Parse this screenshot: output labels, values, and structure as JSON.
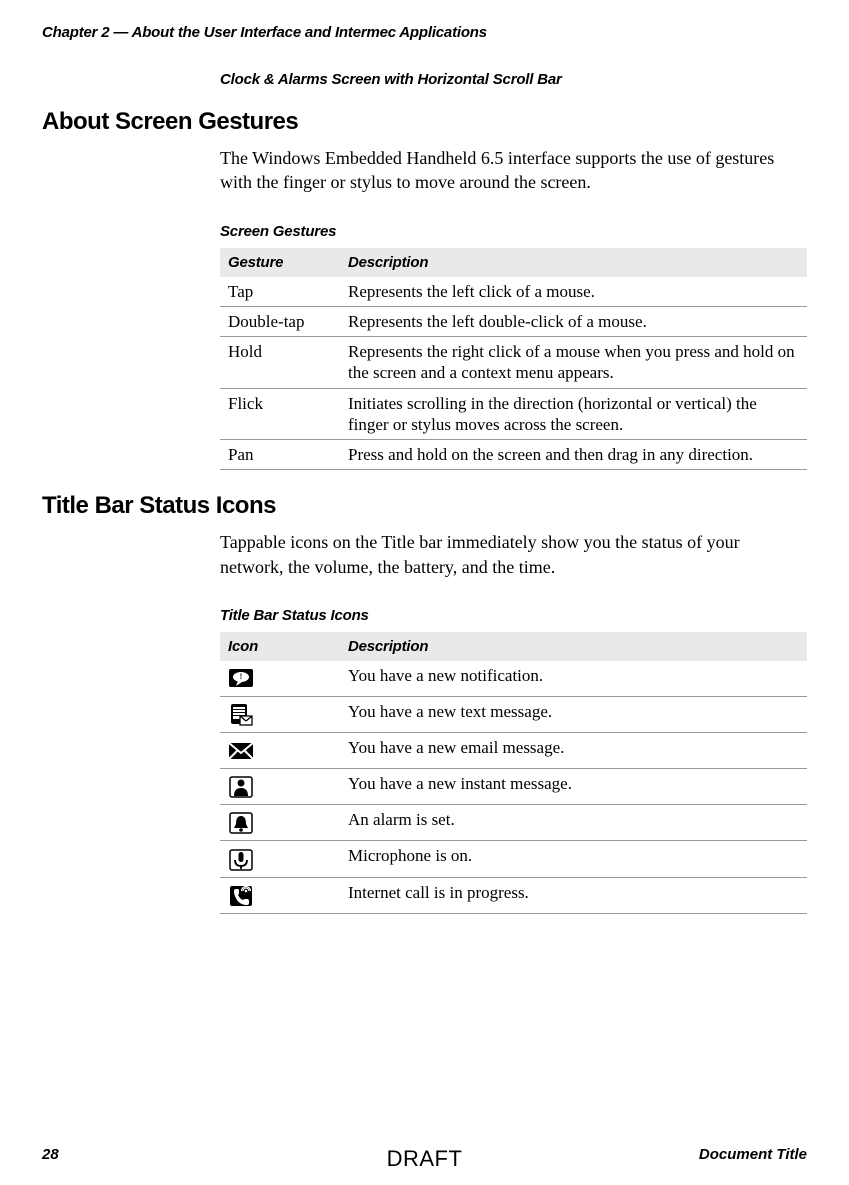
{
  "header": "Chapter 2 — About the User Interface and Intermec Applications",
  "caption_top": "Clock & Alarms Screen with Horizontal Scroll Bar",
  "section1": {
    "title": "About Screen Gestures",
    "body": "The Windows Embedded Handheld 6.5 interface supports the use of gestures with the finger or stylus to move around the screen.",
    "table_caption": "Screen Gestures",
    "table_headers": {
      "col1": "Gesture",
      "col2": "Description"
    },
    "rows": [
      {
        "gesture": "Tap",
        "desc": "Represents the left click of a mouse."
      },
      {
        "gesture": "Double-tap",
        "desc": "Represents the left double-click of a mouse."
      },
      {
        "gesture": "Hold",
        "desc": "Represents the right click of a mouse when you press and hold on the screen and a context menu appears."
      },
      {
        "gesture": "Flick",
        "desc": "Initiates scrolling in the direction (horizontal or vertical) the finger or stylus moves across the screen."
      },
      {
        "gesture": "Pan",
        "desc": "Press and hold on the screen and then drag in any direction."
      }
    ]
  },
  "section2": {
    "title": "Title Bar Status Icons",
    "body": "Tappable icons on the Title bar immediately show you the status of your network, the volume, the battery, and the time.",
    "table_caption": "Title Bar Status Icons",
    "table_headers": {
      "col1": "Icon",
      "col2": "Description"
    },
    "rows": [
      {
        "icon": "notification-icon",
        "desc": "You have a new notification."
      },
      {
        "icon": "text-message-icon",
        "desc": "You have a new text message."
      },
      {
        "icon": "email-icon",
        "desc": "You have a new email message."
      },
      {
        "icon": "instant-message-icon",
        "desc": "You have a new instant message."
      },
      {
        "icon": "alarm-icon",
        "desc": "An alarm is set."
      },
      {
        "icon": "microphone-icon",
        "desc": "Microphone is on."
      },
      {
        "icon": "internet-call-icon",
        "desc": "Internet call is in progress."
      }
    ]
  },
  "footer": {
    "page_number": "28",
    "watermark": "DRAFT",
    "doc_title": "Document Title"
  }
}
